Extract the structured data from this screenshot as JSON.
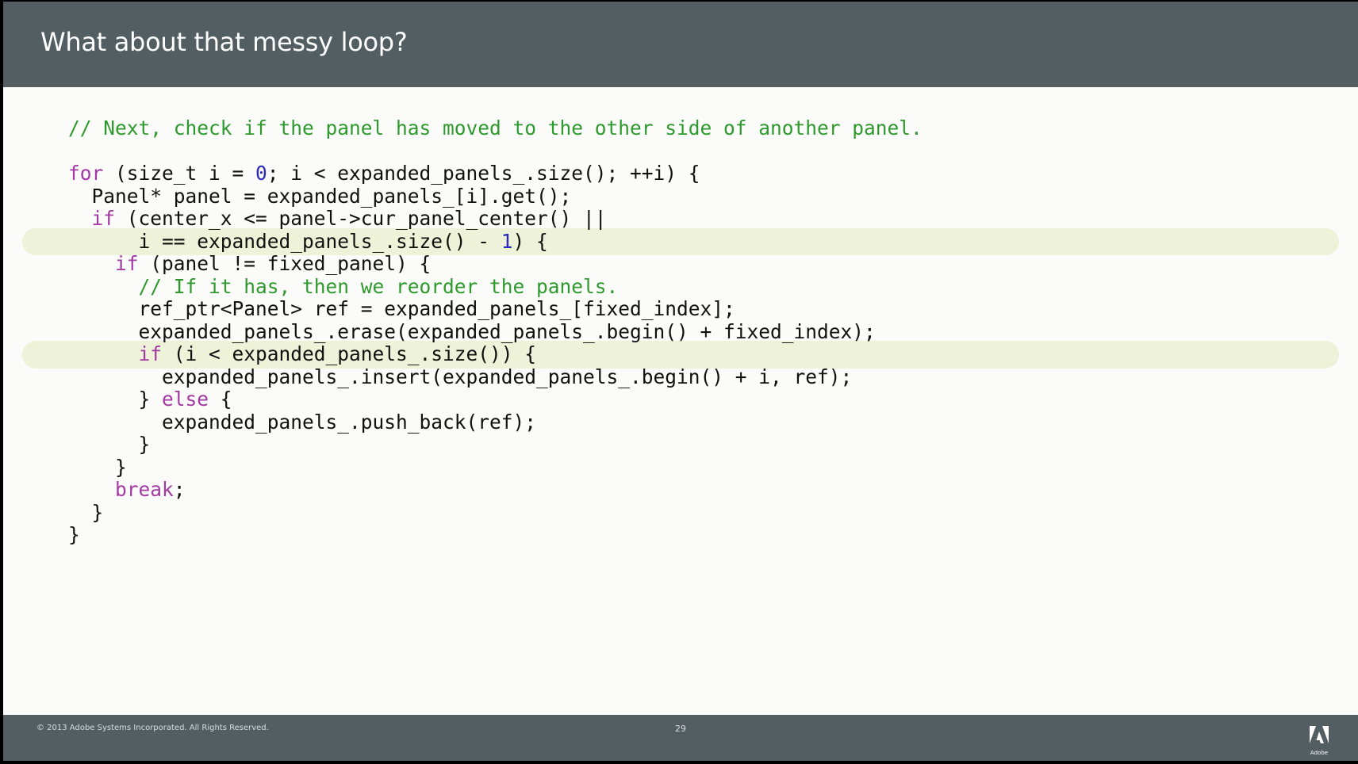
{
  "slide": {
    "title": "What about that messy loop?",
    "footer": {
      "copyright": "© 2013 Adobe Systems Incorporated.  All Rights Reserved.",
      "page_number": "29",
      "logo_text": "Adobe"
    }
  },
  "code": {
    "lines": [
      {
        "text": "// Next, check if the panel has moved to the other side of another panel.",
        "highlight": false
      },
      {
        "text": "",
        "highlight": false
      },
      {
        "text": "for (size_t i = 0; i < expanded_panels_.size(); ++i) {",
        "highlight": false
      },
      {
        "text": "  Panel* panel = expanded_panels_[i].get();",
        "highlight": false
      },
      {
        "text": "  if (center_x <= panel->cur_panel_center() ||",
        "highlight": false
      },
      {
        "text": "      i == expanded_panels_.size() - 1) {",
        "highlight": true
      },
      {
        "text": "    if (panel != fixed_panel) {",
        "highlight": false
      },
      {
        "text": "      // If it has, then we reorder the panels.",
        "highlight": false
      },
      {
        "text": "      ref_ptr<Panel> ref = expanded_panels_[fixed_index];",
        "highlight": false
      },
      {
        "text": "      expanded_panels_.erase(expanded_panels_.begin() + fixed_index);",
        "highlight": false
      },
      {
        "text": "      if (i < expanded_panels_.size()) {",
        "highlight": true
      },
      {
        "text": "        expanded_panels_.insert(expanded_panels_.begin() + i, ref);",
        "highlight": false
      },
      {
        "text": "      } else {",
        "highlight": false
      },
      {
        "text": "        expanded_panels_.push_back(ref);",
        "highlight": false
      },
      {
        "text": "      }",
        "highlight": false
      },
      {
        "text": "    }",
        "highlight": false
      },
      {
        "text": "    break;",
        "highlight": false
      },
      {
        "text": "  }",
        "highlight": false
      },
      {
        "text": "}",
        "highlight": false
      }
    ]
  },
  "colors": {
    "header_bg": "#535e63",
    "slide_bg": "#fbfbf9",
    "keyword": "#a33aa3",
    "comment": "#2e9a2e",
    "number": "#2a2ab8",
    "highlight": "#eef2d8"
  }
}
